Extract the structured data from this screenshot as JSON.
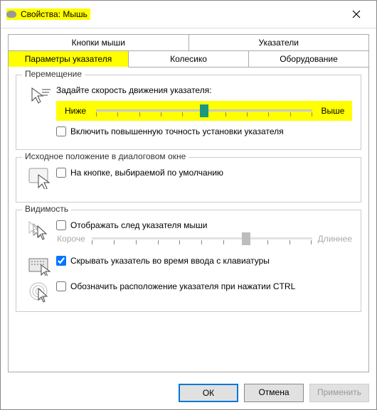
{
  "window": {
    "title": "Свойства: Мышь"
  },
  "tabs": {
    "row1": [
      "Кнопки мыши",
      "Указатели"
    ],
    "row2": [
      "Параметры указателя",
      "Колесико",
      "Оборудование"
    ],
    "active": "Параметры указателя"
  },
  "groups": {
    "motion": {
      "title": "Перемещение",
      "speed_text": "Задайте скорость движения указателя:",
      "slider": {
        "low": "Ниже",
        "high": "Выше",
        "value": 5,
        "min": 0,
        "max": 10
      },
      "enhance_precision": {
        "label": "Включить повышенную точность установки указателя",
        "checked": false
      }
    },
    "snapto": {
      "title": "Исходное положение в диалоговом окне",
      "option": {
        "label": "На кнопке, выбираемой по умолчанию",
        "checked": false
      }
    },
    "visibility": {
      "title": "Видимость",
      "trails": {
        "label": "Отображать след указателя мыши",
        "checked": false
      },
      "trail_slider": {
        "low": "Короче",
        "high": "Длиннее",
        "value": 7,
        "min": 0,
        "max": 10,
        "disabled": true
      },
      "hide_typing": {
        "label": "Скрывать указатель во время ввода с клавиатуры",
        "checked": true
      },
      "ctrl_locate": {
        "label": "Обозначить расположение указателя при нажатии CTRL",
        "checked": false
      }
    }
  },
  "buttons": {
    "ok": "ОК",
    "cancel": "Отмена",
    "apply": "Применить"
  }
}
